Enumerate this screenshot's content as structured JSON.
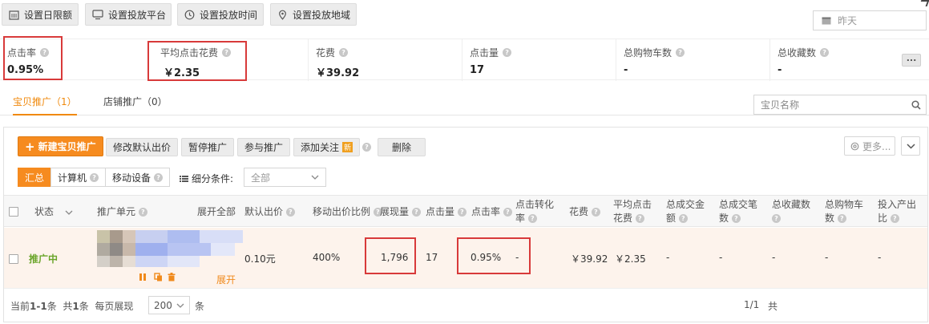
{
  "top_toolbar": {
    "buttons": [
      "设置日限额",
      "设置投放平台",
      "设置投放时间",
      "设置投放地域"
    ],
    "date_picker": "昨天"
  },
  "metrics": [
    {
      "label": "点击率",
      "value": "0.95%"
    },
    {
      "label": "平均点击花费",
      "value": "￥2.35"
    },
    {
      "label": "花费",
      "value": "￥39.92"
    },
    {
      "label": "点击量",
      "value": "17"
    },
    {
      "label": "总购物车数",
      "value": "-"
    },
    {
      "label": "总收藏数",
      "value": "-"
    }
  ],
  "metrics_more": "...",
  "tabs": [
    "宝贝推广（1）",
    "店铺推广（0）"
  ],
  "search": {
    "placeholder": "宝贝名称"
  },
  "actions": {
    "new_promo": "新建宝贝推广",
    "buttons": [
      "修改默认出价",
      "暂停推广",
      "参与推广",
      "添加关注",
      "删除"
    ],
    "new_badge": "新",
    "more": "更多..."
  },
  "segments": [
    "汇总",
    "计算机",
    "移动设备"
  ],
  "filter": {
    "label": "细分条件:",
    "value": "全部"
  },
  "table": {
    "headers": {
      "status": "状态",
      "unit": "推广单元",
      "expand_all": "展开全部",
      "default_bid": "默认出价",
      "mobile_ratio": "移动出价比例",
      "impressions": "展现量",
      "clicks": "点击量",
      "ctr": "点击率",
      "cvr_line1": "点击转化",
      "cvr_line2": "率",
      "cost": "花费",
      "cpc_line1": "平均点击",
      "cpc_line2": "花费",
      "deal_amount_line1": "总成交金",
      "deal_amount_line2": "额",
      "deal_count_line1": "总成交笔",
      "deal_count_line2": "数",
      "favorites": "总收藏数",
      "cart_line1": "总购物车",
      "cart_line2": "数",
      "roi_line1": "投入产出",
      "roi_line2": "比"
    },
    "row": {
      "status": "推广中",
      "expand": "展开",
      "default_bid": "0.10元",
      "mobile_ratio": "400%",
      "impressions": "1,796",
      "clicks": "17",
      "ctr": "0.95%",
      "cvr": "-",
      "cost": "￥39.92",
      "cpc": "￥2.35",
      "deal_amount": "-",
      "deal_count": "-",
      "favorites": "-",
      "cart": "-",
      "roi": "-"
    }
  },
  "footer": {
    "current_label": "当前",
    "current_range": "1-1",
    "item_unit": "条",
    "total_label": "共",
    "total_count": "1",
    "per_page_label": "每页展现",
    "page_size": "200",
    "page_indicator": "1/1",
    "total_suffix": "共"
  },
  "colors": {
    "accent": "#f68b1f",
    "highlight": "#d83a3a",
    "status_active": "#6aa52a"
  }
}
